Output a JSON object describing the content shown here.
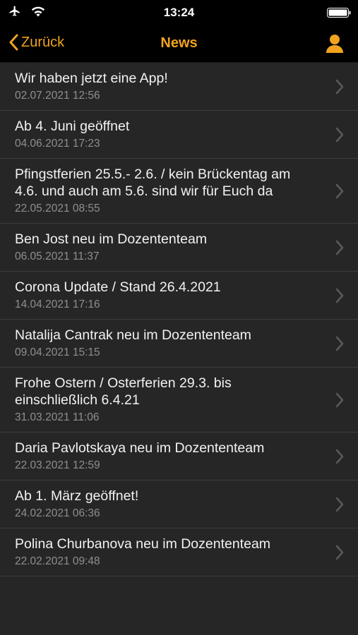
{
  "status_bar": {
    "time": "13:24",
    "icons": [
      "airplane-icon",
      "wifi-icon",
      "battery-icon"
    ]
  },
  "nav": {
    "back_label": "Zurück",
    "title": "News",
    "profile_icon": "person-icon"
  },
  "colors": {
    "accent": "#f1a31f",
    "background": "#262626",
    "bar": "#000000",
    "date": "#8f8f8f",
    "separator": "#3d3d3d"
  },
  "news": [
    {
      "title": "Wir haben jetzt eine App!",
      "date": "02.07.2021 12:56"
    },
    {
      "title": "Ab 4. Juni geöffnet",
      "date": "04.06.2021 17:23"
    },
    {
      "title": "Pfingstferien 25.5.- 2.6. / kein Brückentag am 4.6. und auch am 5.6. sind wir für Euch da",
      "date": "22.05.2021 08:55"
    },
    {
      "title": "Ben Jost neu im Dozententeam",
      "date": "06.05.2021 11:37"
    },
    {
      "title": "Corona Update / Stand 26.4.2021",
      "date": "14.04.2021 17:16"
    },
    {
      "title": "Natalija Cantrak neu im Dozententeam",
      "date": "09.04.2021 15:15"
    },
    {
      "title": "Frohe Ostern / Osterferien 29.3. bis einschließlich 6.4.21",
      "date": "31.03.2021 11:06"
    },
    {
      "title": "Daria Pavlotskaya neu im Dozententeam",
      "date": "22.03.2021 12:59"
    },
    {
      "title": "Ab 1. März geöffnet!",
      "date": "24.02.2021 06:36"
    },
    {
      "title": "Polina Churbanova neu im Dozententeam",
      "date": "22.02.2021 09:48"
    }
  ]
}
